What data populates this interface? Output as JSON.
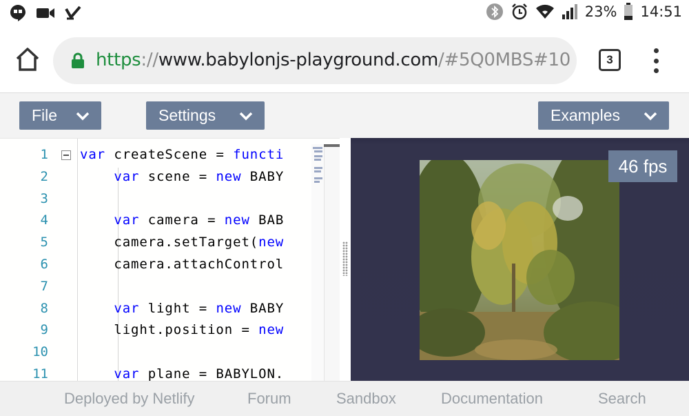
{
  "status_bar": {
    "battery": "23%",
    "time": "14:51",
    "left_icons": [
      "hangouts-icon",
      "video-call-icon",
      "task-check-icon"
    ],
    "right_icons": [
      "bluetooth-icon",
      "alarm-icon",
      "wifi-icon",
      "signal-icon",
      "battery-icon"
    ]
  },
  "browser": {
    "url_scheme": "https",
    "url_sep": "://",
    "url_host": "www.babylonjs-playground.com",
    "url_path": "/#5Q0MBS#10",
    "tab_count": "3"
  },
  "toolbar": {
    "file_label": "File",
    "settings_label": "Settings",
    "examples_label": "Examples"
  },
  "editor": {
    "line_numbers": [
      "1",
      "2",
      "3",
      "4",
      "5",
      "6",
      "7",
      "8",
      "9",
      "10",
      "11"
    ],
    "lines": [
      {
        "kw": "var",
        "text": " createScene = ",
        "kw2": "functi",
        "rest": ""
      },
      {
        "kw": "    var",
        "text": " scene = ",
        "kw2": "new",
        "rest": " BABY"
      },
      {
        "kw": "",
        "text": "",
        "kw2": "",
        "rest": ""
      },
      {
        "kw": "    var",
        "text": " camera = ",
        "kw2": "new",
        "rest": " BAB"
      },
      {
        "kw": "",
        "text": "    camera.setTarget(",
        "kw2": "new",
        "rest": ""
      },
      {
        "kw": "",
        "text": "    camera.attachControl",
        "kw2": "",
        "rest": ""
      },
      {
        "kw": "",
        "text": "",
        "kw2": "",
        "rest": ""
      },
      {
        "kw": "    var",
        "text": " light = ",
        "kw2": "new",
        "rest": " BABY"
      },
      {
        "kw": "",
        "text": "    light.position = ",
        "kw2": "new",
        "rest": ""
      },
      {
        "kw": "",
        "text": "",
        "kw2": "",
        "rest": ""
      },
      {
        "kw": "    var",
        "text": " plane = BABYLON.",
        "kw2": "",
        "rest": ""
      }
    ]
  },
  "render": {
    "fps": "46 fps",
    "background": "#33334c"
  },
  "footer": {
    "links": [
      "Deployed by Netlify",
      "Forum",
      "Sandbox",
      "Documentation",
      "Search"
    ]
  },
  "colors": {
    "accent": "#6b7d98",
    "secure_green": "#1e8e3e",
    "keyword_blue": "#0000ff",
    "line_number_blue": "#2b91af"
  }
}
